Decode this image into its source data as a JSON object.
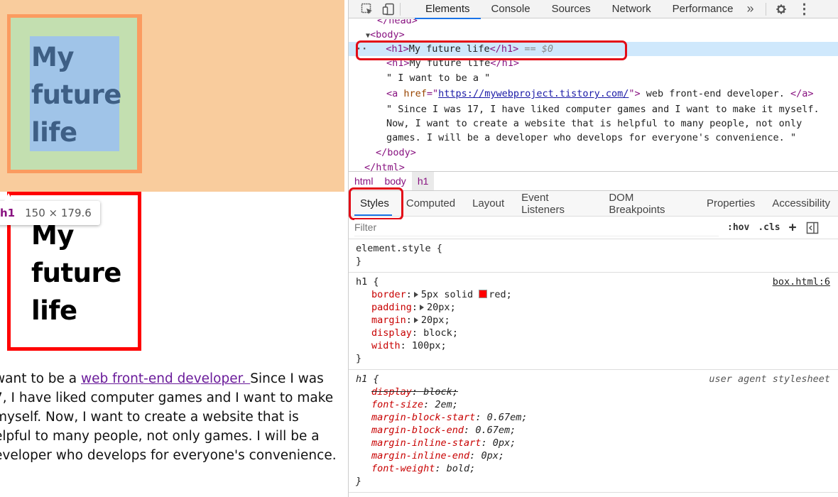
{
  "page": {
    "heading": "My future life",
    "heading_lines": [
      "My",
      "future",
      "life"
    ],
    "tooltip": {
      "tag": "h1",
      "dims": "150 × 179.6"
    },
    "paragraph": {
      "line1_prefix": "want to be a ",
      "link_text": "web front-end developer. ",
      "line1_suffix": "Since I was",
      "line2": "7, I have liked computer games and I want to make",
      "line3": " myself. Now, I want to create a website that is",
      "line4": "elpful to many people, not only games. I will be a",
      "line5": "eveloper who develops for everyone's convenience."
    }
  },
  "devtools": {
    "tabs": [
      "Elements",
      "Console",
      "Sources",
      "Network",
      "Performance"
    ],
    "active_tab": "Elements",
    "more_icon": "chevrons-right-icon",
    "dom": {
      "head_close": "</head>",
      "body_open": "<body>",
      "selected_h1_open": "<h1>",
      "selected_h1_text": "My future life",
      "selected_h1_close": "</h1>",
      "selected_marker": "== $0",
      "h1_second": "My future life",
      "text1": "\" I want to be a \"",
      "link_href": "https://mywebproject.tistory.com/",
      "link_text": " web front-end developer. ",
      "text2_l1": "\" Since I was 17, I have liked computer games and I want to make it myself.",
      "text2_l2": "Now, I want to create a website that is helpful to many people, not only",
      "text2_l3": "games. I will be a developer who develops for everyone's convenience. \"",
      "body_close": "</body>",
      "html_close": "</html>"
    },
    "breadcrumbs": [
      "html",
      "body",
      "h1"
    ],
    "subtabs": [
      "Styles",
      "Computed",
      "Layout",
      "Event Listeners",
      "DOM Breakpoints",
      "Properties",
      "Accessibility"
    ],
    "filter_placeholder": "Filter",
    "filter_buttons": [
      ":hov",
      ".cls",
      "+"
    ],
    "rules": {
      "element_style": "element.style {",
      "close": "}",
      "h1_selector": "h1 {",
      "h1_source": "box.html:6",
      "h1_decls": [
        {
          "prop": "border",
          "value": "5px solid",
          "color_name": "red",
          "color": "#ff0000"
        },
        {
          "prop": "padding",
          "value": "20px"
        },
        {
          "prop": "margin",
          "value": "20px"
        },
        {
          "prop": "display",
          "value": "block"
        },
        {
          "prop": "width",
          "value": "100px"
        }
      ],
      "ua_selector": "h1 {",
      "ua_source": "user agent stylesheet",
      "ua_decls": [
        {
          "prop": "display",
          "value": "block",
          "struck": true
        },
        {
          "prop": "font-size",
          "value": "2em"
        },
        {
          "prop": "margin-block-start",
          "value": "0.67em"
        },
        {
          "prop": "margin-block-end",
          "value": "0.67em"
        },
        {
          "prop": "margin-inline-start",
          "value": "0px"
        },
        {
          "prop": "margin-inline-end",
          "value": "0px"
        },
        {
          "prop": "font-weight",
          "value": "bold"
        }
      ]
    }
  }
}
